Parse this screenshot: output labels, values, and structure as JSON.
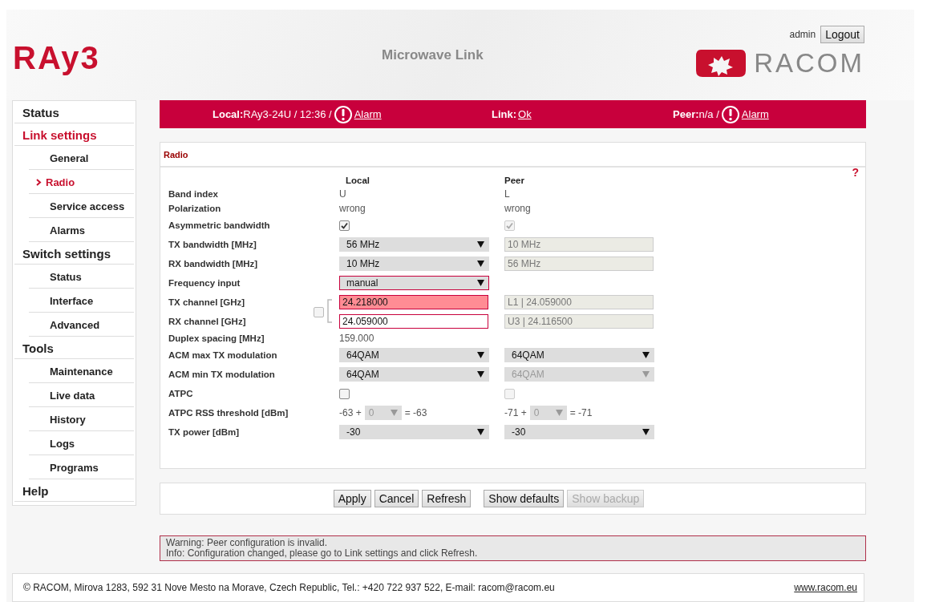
{
  "header": {
    "product": "RAy3",
    "title": "Microwave Link",
    "user": "admin",
    "logout": "Logout",
    "brand": "RACOM"
  },
  "sidebar": {
    "items": [
      {
        "label": "Status",
        "selected": false
      },
      {
        "label": "Link settings",
        "selected": true,
        "children": [
          {
            "label": "General",
            "selected": false
          },
          {
            "label": "Radio",
            "selected": true
          },
          {
            "label": "Service access",
            "selected": false
          },
          {
            "label": "Alarms",
            "selected": false
          }
        ]
      },
      {
        "label": "Switch settings",
        "selected": false,
        "children": [
          {
            "label": "Status",
            "selected": false
          },
          {
            "label": "Interface",
            "selected": false
          },
          {
            "label": "Advanced",
            "selected": false
          }
        ]
      },
      {
        "label": "Tools",
        "selected": false,
        "children": [
          {
            "label": "Maintenance",
            "selected": false
          },
          {
            "label": "Live data",
            "selected": false
          },
          {
            "label": "History",
            "selected": false
          },
          {
            "label": "Logs",
            "selected": false
          },
          {
            "label": "Programs",
            "selected": false
          }
        ]
      },
      {
        "label": "Help",
        "selected": false
      }
    ]
  },
  "status_bar": [
    {
      "label": "Local:",
      "value": "RAy3-24U / 12:36 /",
      "alarm": true,
      "link": "Alarm"
    },
    {
      "label": "Link:",
      "alarm": false,
      "link": "Ok"
    },
    {
      "label": "Peer:",
      "value": "n/a /",
      "alarm": true,
      "link": "Alarm"
    }
  ],
  "panel": {
    "title": "Radio",
    "help": "?",
    "columns": [
      "Local",
      "Peer"
    ],
    "channel_lock": {
      "checked": false
    },
    "rows": [
      {
        "label": "Band index",
        "local": {
          "kind": "text",
          "value": "U"
        },
        "peer": {
          "kind": "text",
          "value": "L"
        }
      },
      {
        "label": "Polarization",
        "local": {
          "kind": "text",
          "value": "wrong"
        },
        "peer": {
          "kind": "text",
          "value": "wrong"
        }
      },
      {
        "label": "Asymmetric bandwidth",
        "local": {
          "kind": "checkbox",
          "checked": true,
          "disabled": false
        },
        "peer": {
          "kind": "checkbox",
          "checked": true,
          "disabled": true
        }
      },
      {
        "label": "TX bandwidth [MHz]",
        "local": {
          "kind": "select",
          "value": "56 MHz",
          "disabled": false,
          "invalid": false,
          "highlighted": false
        },
        "peer": {
          "kind": "input",
          "value": "10 MHz",
          "disabled": true,
          "invalid": false,
          "highlighted": false
        }
      },
      {
        "label": "RX bandwidth [MHz]",
        "local": {
          "kind": "select",
          "value": "10 MHz",
          "disabled": false,
          "invalid": false,
          "highlighted": false
        },
        "peer": {
          "kind": "input",
          "value": "56 MHz",
          "disabled": true,
          "invalid": false,
          "highlighted": false
        }
      },
      {
        "label": "Frequency input",
        "local": {
          "kind": "select",
          "value": "manual",
          "disabled": false,
          "invalid": true,
          "highlighted": false
        }
      },
      {
        "label": "TX channel [GHz]",
        "local": {
          "kind": "input",
          "value": "24.218000",
          "disabled": false,
          "invalid": true,
          "highlighted": true
        },
        "peer": {
          "kind": "input",
          "value": "L1 | 24.059000",
          "disabled": true,
          "invalid": false,
          "highlighted": false
        }
      },
      {
        "label": "RX channel [GHz]",
        "local": {
          "kind": "input",
          "value": "24.059000",
          "disabled": false,
          "invalid": true,
          "highlighted": false
        },
        "peer": {
          "kind": "input",
          "value": "U3 | 24.116500",
          "disabled": true,
          "invalid": false,
          "highlighted": false
        }
      },
      {
        "label": "Duplex spacing [MHz]",
        "local": {
          "kind": "text",
          "value": "159.000"
        }
      },
      {
        "label": "ACM max TX modulation",
        "local": {
          "kind": "select",
          "value": "64QAM",
          "disabled": false,
          "invalid": false,
          "highlighted": false
        },
        "peer": {
          "kind": "select",
          "value": "64QAM",
          "disabled": false,
          "invalid": false,
          "highlighted": false
        }
      },
      {
        "label": "ACM min TX modulation",
        "local": {
          "kind": "select",
          "value": "64QAM",
          "disabled": false,
          "invalid": false,
          "highlighted": false
        },
        "peer": {
          "kind": "select",
          "value": "64QAM",
          "disabled": true,
          "invalid": false,
          "highlighted": false
        }
      },
      {
        "label": "ATPC",
        "local": {
          "kind": "checkbox",
          "checked": false,
          "disabled": false
        },
        "peer": {
          "kind": "checkbox",
          "checked": false,
          "disabled": true
        }
      },
      {
        "label": "ATPC RSS threshold [dBm]",
        "local": {
          "kind": "threshold",
          "base": "-63 +",
          "value": "0",
          "result": "= -63"
        },
        "peer": {
          "kind": "threshold",
          "base": "-71 +",
          "value": "0",
          "result": "= -71"
        }
      },
      {
        "label": "TX power [dBm]",
        "local": {
          "kind": "select",
          "value": "-30",
          "disabled": false,
          "invalid": false,
          "highlighted": false
        },
        "peer": {
          "kind": "select",
          "value": "-30",
          "disabled": false,
          "invalid": false,
          "highlighted": false
        }
      }
    ]
  },
  "button_groups": [
    {
      "buttons": [
        {
          "label": "Apply",
          "disabled": false
        },
        {
          "label": "Cancel",
          "disabled": false
        },
        {
          "label": "Refresh",
          "disabled": false
        }
      ]
    },
    {
      "buttons": [
        {
          "label": "Show defaults",
          "disabled": false
        },
        {
          "label": "Show backup",
          "disabled": true
        }
      ]
    }
  ],
  "messages": [
    "Warning: Peer configuration is invalid.",
    "Info: Configuration changed, please go to Link settings and click Refresh."
  ],
  "footer": {
    "text": "© RACOM, Mirova 1283, 592 31 Nove Mesto na Morave, Czech Republic, Tel.: +420 722 937 522, E-mail: racom@racom.eu",
    "link": "www.racom.eu"
  }
}
